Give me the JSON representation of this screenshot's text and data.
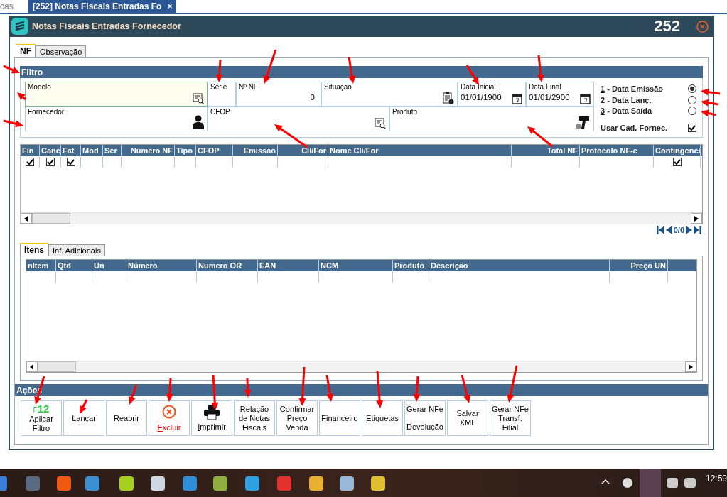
{
  "app_tabs": [
    {
      "label": "cas",
      "selected": false
    },
    {
      "label": "[252] Notas Fiscais Entradas Fo",
      "selected": true,
      "close": "×"
    }
  ],
  "window": {
    "title": "Notas Fiscais Entradas Fornecedor",
    "number": "252"
  },
  "tabs": [
    {
      "label": "NF",
      "selected": true
    },
    {
      "label": "Observação",
      "selected": false
    }
  ],
  "filter": {
    "title": "Filtro",
    "rows": [
      [
        {
          "label": "Modelo",
          "focused": true,
          "kind": "lookup"
        },
        {
          "label": "Série",
          "kind": "text"
        },
        {
          "label": "Nº NF",
          "value": "0",
          "kind": "number"
        },
        {
          "label": "Situação",
          "kind": "status"
        },
        {
          "label": "Data Inicial",
          "value": "01/01/1900",
          "kind": "date"
        },
        {
          "label": "Data Final",
          "value": "01/01/2900",
          "kind": "date"
        }
      ],
      [
        {
          "label": "Fornecedor",
          "kind": "person"
        },
        {
          "label": "CFOP",
          "kind": "lookup"
        },
        {
          "label": "Produto",
          "kind": "product"
        }
      ]
    ],
    "date_options": [
      {
        "number": "1",
        "label": " - Data Emissão",
        "underline": true,
        "selected": true
      },
      {
        "number": "2",
        "label": " - Data Lanç.",
        "underline": false,
        "selected": false
      },
      {
        "number": "3",
        "label": " - Data Saída",
        "underline": true,
        "selected": false
      }
    ],
    "supplier_option": {
      "label": "Usar Cad. Fornec.",
      "checked": true
    }
  },
  "nf_table": {
    "columns": [
      "Fin",
      "Canc",
      "Fat",
      "Mod",
      "Ser",
      "Número NF",
      "Tipo",
      "CFOP",
      "Emissão",
      "Cli/For",
      "Nome Cli/For",
      "Total NF",
      "Protocolo NF-e",
      "Contingenci"
    ],
    "rows": [
      {
        "cells": [
          {
            "kind": "checkbox",
            "checked": true
          },
          {
            "kind": "checkbox",
            "checked": true
          },
          {
            "kind": "checkbox",
            "checked": true
          },
          {
            "kind": "blank"
          },
          {
            "kind": "blank"
          },
          {
            "kind": "blank"
          },
          {
            "kind": "blank"
          },
          {
            "kind": "blank"
          },
          {
            "kind": "blank"
          },
          {
            "kind": "blank"
          },
          {
            "kind": "blank"
          },
          {
            "kind": "blank"
          },
          {
            "kind": "blank"
          },
          {
            "kind": "checkbox",
            "checked": true
          }
        ]
      }
    ],
    "pager": "0/0"
  },
  "detail_tabs": [
    {
      "label": "Itens",
      "selected": true
    },
    {
      "label": "Inf. Adicionais",
      "selected": false
    }
  ],
  "items_table": {
    "columns": [
      "nItem",
      "Qtd",
      "Un",
      "Número",
      "Numero OR",
      "EAN",
      "NCM",
      "Produto",
      "Descrição",
      "Preço UN"
    ]
  },
  "actions": {
    "title": "Ações",
    "buttons": [
      {
        "kind": "hotkey",
        "lines": [
          "Aplicar",
          "Filtro"
        ],
        "underline_first": false,
        "hotkey_prefix": "F",
        "hotkey": "12"
      },
      {
        "kind": "text",
        "lines": [
          "Lançar"
        ],
        "underline_first": true
      },
      {
        "kind": "text",
        "lines": [
          "Reabrir"
        ],
        "underline_first": true
      },
      {
        "kind": "delete",
        "lines": [
          "Excluir"
        ],
        "underline_first": true
      },
      {
        "kind": "print",
        "lines": [
          "Imprimir"
        ],
        "underline_first": true
      },
      {
        "kind": "text",
        "lines": [
          "Relação",
          "de Notas",
          "Fiscais"
        ],
        "underline_first": true
      },
      {
        "kind": "text",
        "lines": [
          "Confirmar",
          "Preço",
          "Venda"
        ],
        "underline_first": true
      },
      {
        "kind": "text",
        "lines": [
          "Financeiro"
        ],
        "underline_first": true
      },
      {
        "kind": "text",
        "lines": [
          "Etiquetas"
        ],
        "underline_first": true
      },
      {
        "kind": "split",
        "lines": [
          "Gerar NFe",
          "Devolução"
        ],
        "underline_first": true
      },
      {
        "kind": "text",
        "lines": [
          "Salvar",
          "XML"
        ],
        "underline_first": false
      },
      {
        "kind": "text",
        "lines": [
          "Gerar NFe",
          "Transf.",
          "Filial"
        ],
        "underline_first": true
      }
    ]
  },
  "taskbar": {
    "time": "12:59"
  }
}
